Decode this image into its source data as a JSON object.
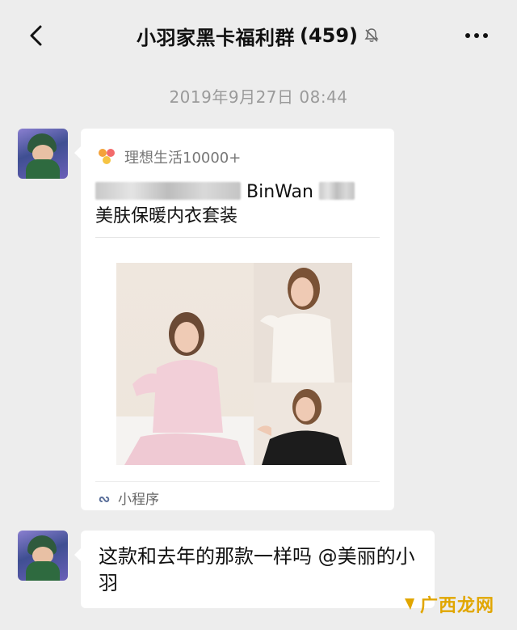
{
  "header": {
    "title": "小羽家黑卡福利群",
    "member_count": "(459)",
    "mute_icon": "bell-off-icon",
    "back_icon": "chevron-left-icon",
    "more_icon": "more-horizontal-icon"
  },
  "timestamp": "2019年9月27日 08:44",
  "messages": [
    {
      "type": "mini-program-card",
      "source": "理想生活10000+",
      "title_visible": "BinWan",
      "title_line2": "美肤保暖内衣套装",
      "footer": "小程序"
    },
    {
      "type": "text",
      "text": "这款和去年的那款一样吗 @美丽的小羽"
    }
  ],
  "watermark": "广西龙网",
  "colors": {
    "background": "#ededed",
    "bubble": "#ffffff",
    "watermark": "#e1a600"
  }
}
